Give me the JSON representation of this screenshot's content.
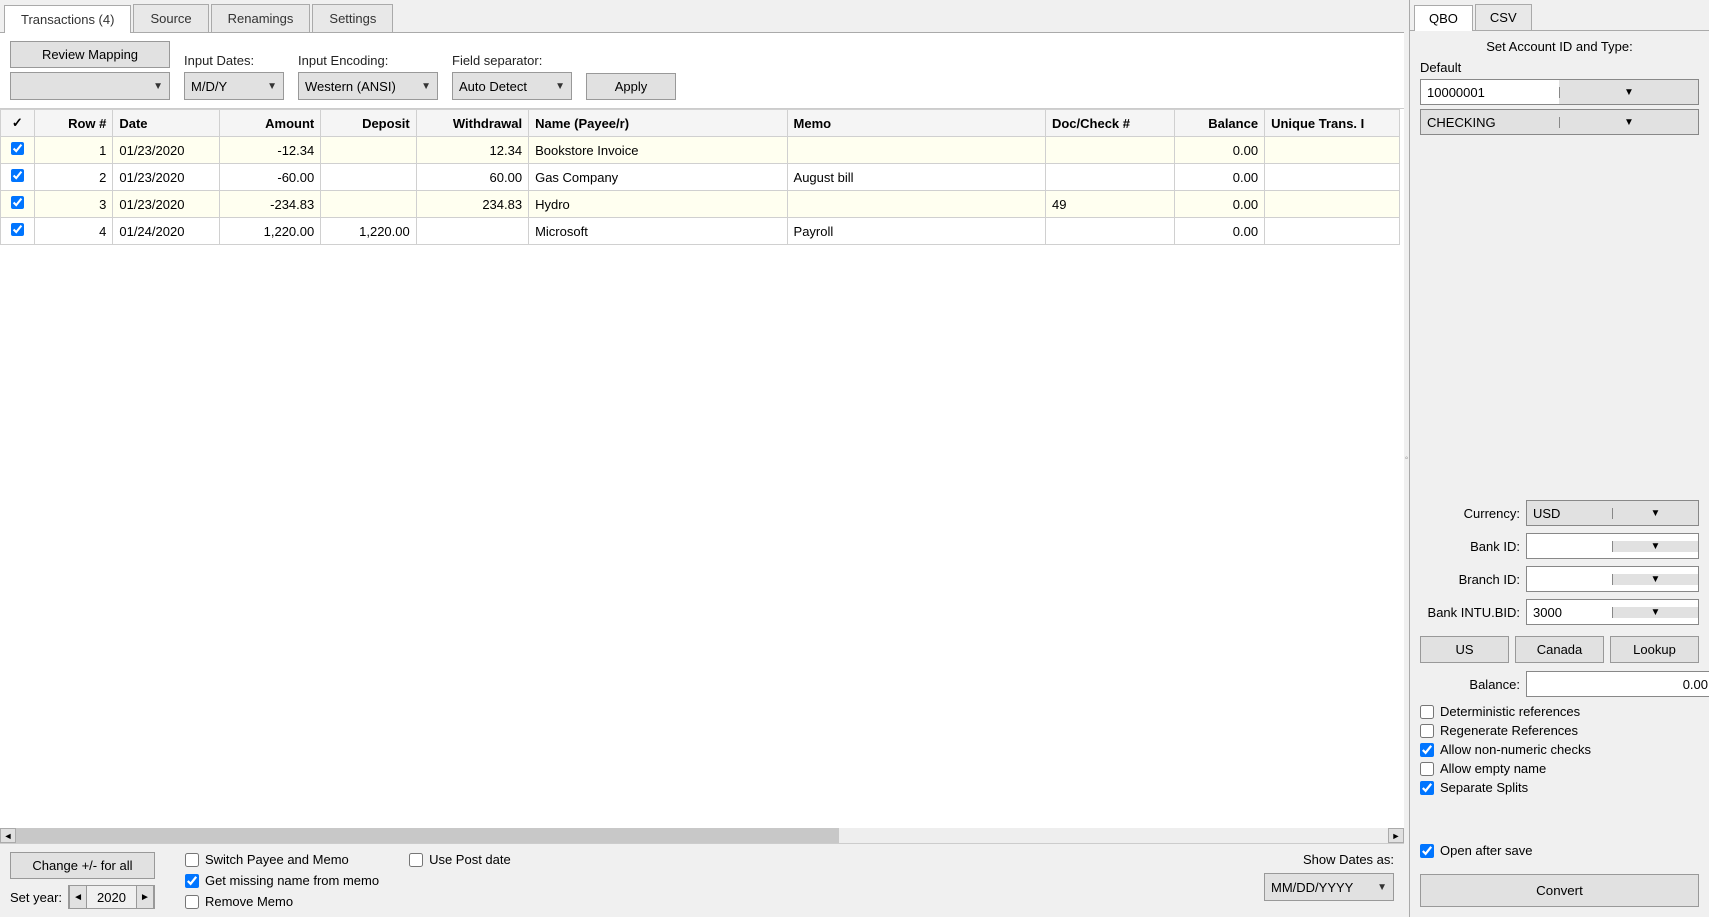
{
  "main_tabs": [
    {
      "label": "Transactions (4)",
      "active": true
    },
    {
      "label": "Source",
      "active": false
    },
    {
      "label": "Renamings",
      "active": false
    },
    {
      "label": "Settings",
      "active": false
    }
  ],
  "toolbar": {
    "review_mapping": "Review Mapping",
    "blank_combo": "",
    "input_dates_label": "Input Dates:",
    "input_dates_value": "M/D/Y",
    "input_encoding_label": "Input Encoding:",
    "input_encoding_value": "Western (ANSI)",
    "field_separator_label": "Field separator:",
    "field_separator_value": "Auto Detect",
    "apply": "Apply"
  },
  "grid": {
    "headers": [
      "✓",
      "Row #",
      "Date",
      "Amount",
      "Deposit",
      "Withdrawal",
      "Name (Payee/r)",
      "Memo",
      "Doc/Check #",
      "Balance",
      "Unique Trans. I"
    ],
    "rows": [
      {
        "checked": true,
        "row": "1",
        "date": "01/23/2020",
        "amount": "-12.34",
        "deposit": "",
        "withdrawal": "12.34",
        "name": "Bookstore Invoice",
        "memo": "",
        "doc": "",
        "balance": "0.00",
        "uid": ""
      },
      {
        "checked": true,
        "row": "2",
        "date": "01/23/2020",
        "amount": "-60.00",
        "deposit": "",
        "withdrawal": "60.00",
        "name": "Gas Company",
        "memo": "August bill",
        "doc": "",
        "balance": "0.00",
        "uid": ""
      },
      {
        "checked": true,
        "row": "3",
        "date": "01/23/2020",
        "amount": "-234.83",
        "deposit": "",
        "withdrawal": "234.83",
        "name": "Hydro",
        "memo": "",
        "doc": "49",
        "balance": "0.00",
        "uid": ""
      },
      {
        "checked": true,
        "row": "4",
        "date": "01/24/2020",
        "amount": "1,220.00",
        "deposit": "1,220.00",
        "withdrawal": "",
        "name": "Microsoft",
        "memo": "Payroll",
        "doc": "",
        "balance": "0.00",
        "uid": ""
      }
    ]
  },
  "bottom": {
    "change_sign": "Change +/- for all",
    "set_year_label": "Set year:",
    "set_year_value": "2020",
    "switch_payee": "Switch Payee and Memo",
    "get_missing": "Get missing name from memo",
    "remove_memo": "Remove Memo",
    "use_post_date": "Use Post date",
    "show_dates_label": "Show Dates as:",
    "show_dates_value": "MM/DD/YYYY"
  },
  "right": {
    "tabs": [
      {
        "label": "QBO",
        "active": true
      },
      {
        "label": "CSV",
        "active": false
      }
    ],
    "title": "Set Account ID and Type:",
    "default_label": "Default",
    "account_id": "10000001",
    "account_type": "CHECKING",
    "currency_label": "Currency:",
    "currency_value": "USD",
    "bank_id_label": "Bank ID:",
    "bank_id_value": "",
    "branch_id_label": "Branch ID:",
    "branch_id_value": "",
    "intubid_label": "Bank INTU.BID:",
    "intubid_value": "3000",
    "us_btn": "US",
    "canada_btn": "Canada",
    "lookup_btn": "Lookup",
    "balance_label": "Balance:",
    "balance_value": "0.00",
    "deterministic": "Deterministic references",
    "regenerate": "Regenerate References",
    "allow_nonnum": "Allow non-numeric checks",
    "allow_empty": "Allow empty name",
    "separate_splits": "Separate Splits",
    "open_after": "Open after save",
    "convert": "Convert"
  }
}
